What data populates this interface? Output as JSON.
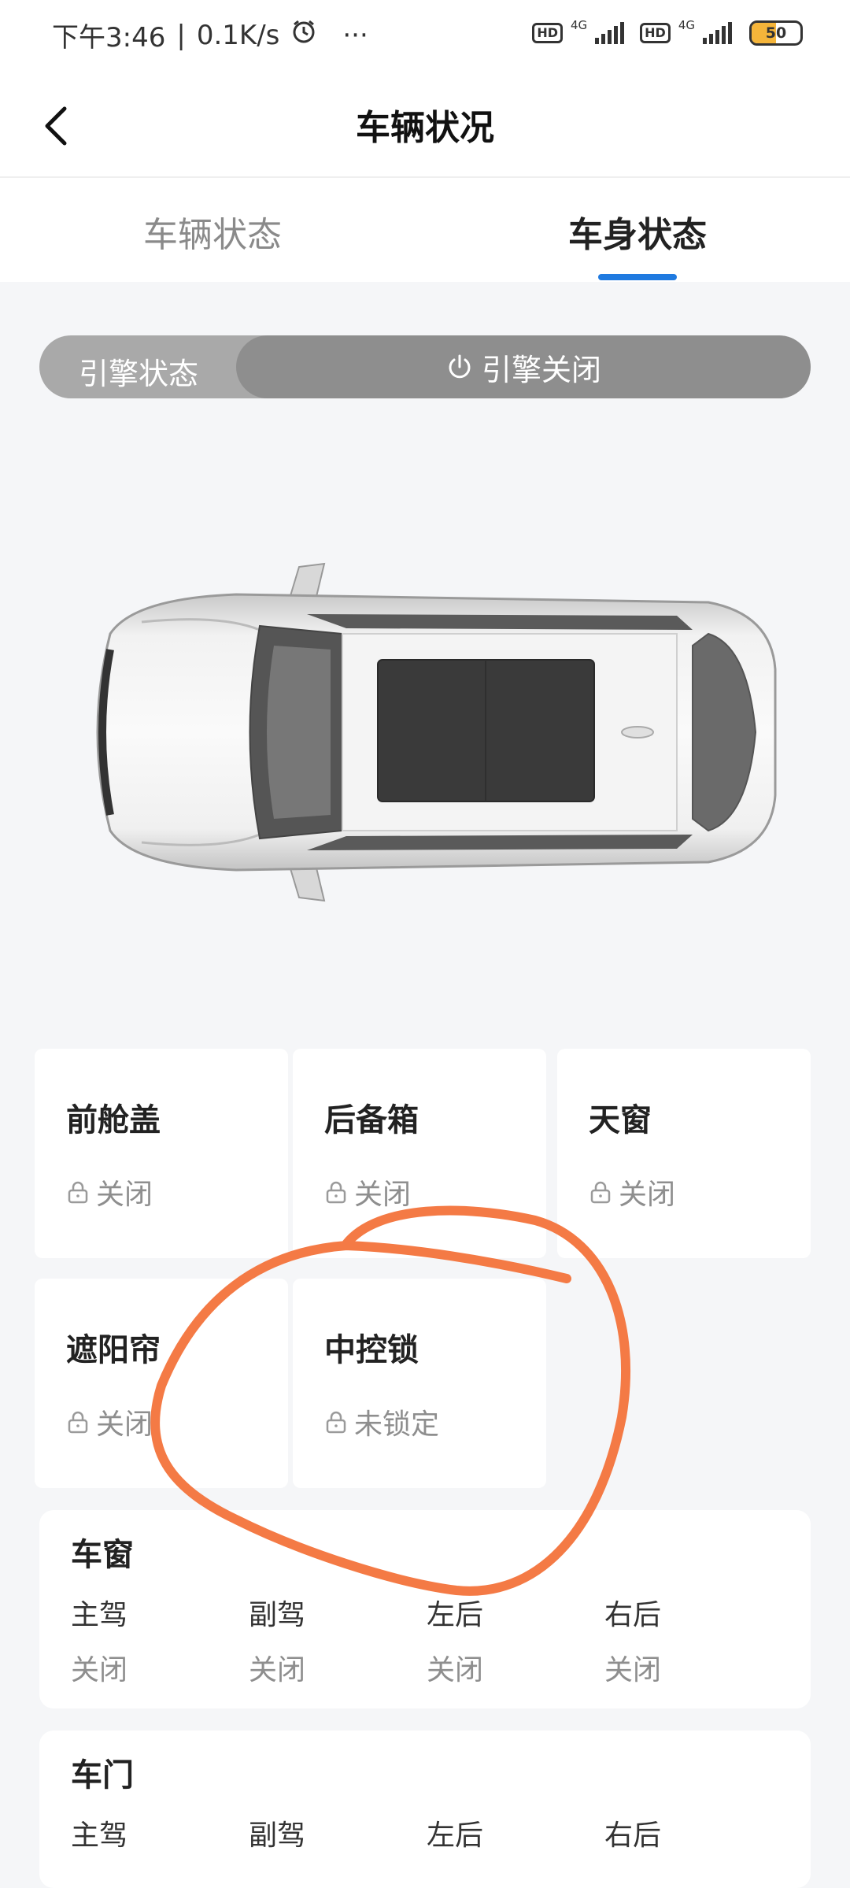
{
  "status_bar": {
    "time": "下午3:46",
    "speed": "0.1K/s",
    "more": "···",
    "hd1": "HD",
    "net1": "4G",
    "hd2": "HD",
    "net2": "4G",
    "battery": "50",
    "battery_level": 0.5
  },
  "header": {
    "title": "车辆状况"
  },
  "tabs": [
    {
      "label": "车辆状态",
      "active": false
    },
    {
      "label": "车身状态",
      "active": true
    }
  ],
  "engine": {
    "label": "引擎状态",
    "state": "引擎关闭"
  },
  "cards": [
    {
      "name": "前舱盖",
      "status": "关闭"
    },
    {
      "name": "后备箱",
      "status": "关闭"
    },
    {
      "name": "天窗",
      "status": "关闭"
    },
    {
      "name": "遮阳帘",
      "status": "关闭"
    },
    {
      "name": "中控锁",
      "status": "未锁定"
    }
  ],
  "windows": {
    "title": "车窗",
    "items": [
      {
        "label": "主驾",
        "value": "关闭"
      },
      {
        "label": "副驾",
        "value": "关闭"
      },
      {
        "label": "左后",
        "value": "关闭"
      },
      {
        "label": "右后",
        "value": "关闭"
      }
    ]
  },
  "doors": {
    "title": "车门",
    "items": [
      {
        "label": "主驾"
      },
      {
        "label": "副驾"
      },
      {
        "label": "左后"
      },
      {
        "label": "右后"
      }
    ]
  },
  "colors": {
    "accent": "#1f7ae0",
    "annotation": "#f47a45",
    "battery": "#f5b53a"
  }
}
